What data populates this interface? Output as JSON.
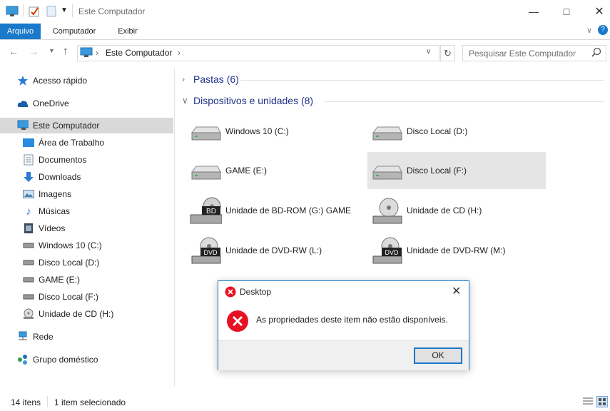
{
  "window": {
    "title": "Este Computador"
  },
  "ribbon": {
    "tabs": [
      "Arquivo",
      "Computador",
      "Exibir"
    ]
  },
  "address": {
    "segments": [
      "Este Computador"
    ]
  },
  "search": {
    "placeholder": "Pesquisar Este Computador"
  },
  "sidebar": {
    "items": [
      {
        "label": "Acesso rápido",
        "icon": "star-icon"
      },
      {
        "label": "OneDrive",
        "icon": "cloud-icon"
      },
      {
        "label": "Este Computador",
        "icon": "computer-icon"
      },
      {
        "label": "Área de Trabalho",
        "icon": "desktop-icon"
      },
      {
        "label": "Documentos",
        "icon": "documents-icon"
      },
      {
        "label": "Downloads",
        "icon": "download-icon"
      },
      {
        "label": "Imagens",
        "icon": "pictures-icon"
      },
      {
        "label": "Músicas",
        "icon": "music-icon"
      },
      {
        "label": "Vídeos",
        "icon": "video-icon"
      },
      {
        "label": "Windows 10 (C:)",
        "icon": "drive-icon"
      },
      {
        "label": "Disco Local (D:)",
        "icon": "drive-icon"
      },
      {
        "label": "GAME (E:)",
        "icon": "drive-icon"
      },
      {
        "label": "Disco Local (F:)",
        "icon": "drive-icon"
      },
      {
        "label": "Unidade de CD (H:)",
        "icon": "cd-drive-icon"
      },
      {
        "label": "Rede",
        "icon": "network-icon"
      },
      {
        "label": "Grupo doméstico",
        "icon": "homegroup-icon"
      }
    ]
  },
  "content": {
    "folders_header": "Pastas (6)",
    "devices_header": "Dispositivos e unidades (8)",
    "drives": [
      {
        "name": "Windows 10 (C:)",
        "icon": "hard-drive-icon"
      },
      {
        "name": "Disco Local (D:)",
        "icon": "hard-drive-icon"
      },
      {
        "name": "GAME (E:)",
        "icon": "hard-drive-icon"
      },
      {
        "name": "Disco Local (F:)",
        "icon": "hard-drive-icon"
      },
      {
        "name": "Unidade de BD-ROM (G:) GAME",
        "icon": "bd-drive-icon",
        "badge": "BD"
      },
      {
        "name": "Unidade de CD (H:)",
        "icon": "cd-drive-icon"
      },
      {
        "name": "Unidade de DVD-RW (L:)",
        "icon": "dvd-drive-icon",
        "badge": "DVD"
      },
      {
        "name": "Unidade de DVD-RW (M:)",
        "icon": "dvd-drive-icon",
        "badge": "DVD"
      }
    ]
  },
  "status": {
    "count": "14 itens",
    "selection": "1 item selecionado"
  },
  "dialog": {
    "title": "Desktop",
    "message": "As propriedades deste item não estão disponíveis.",
    "ok_label": "OK"
  },
  "colors": {
    "accent": "#1979ca",
    "error": "#e81123",
    "header": "#1e3287"
  }
}
